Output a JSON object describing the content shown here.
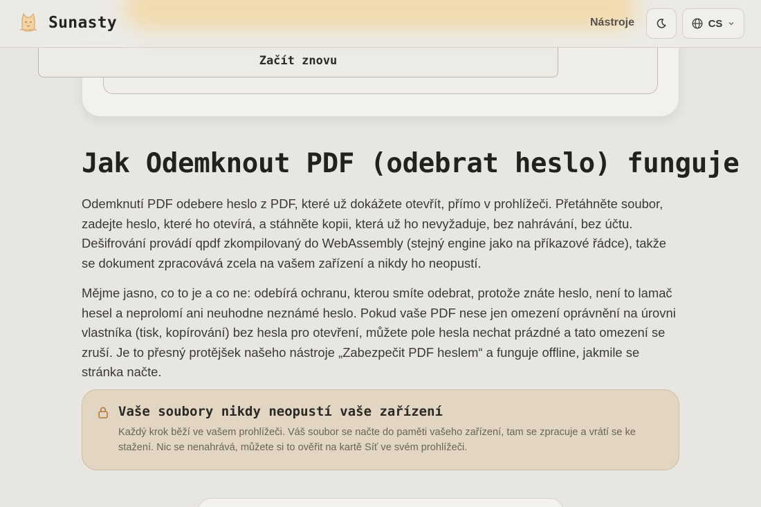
{
  "header": {
    "brand": "Sunasty",
    "nav_tools": "Nástroje",
    "lang": "CS",
    "icons": {
      "logo": "cat-logo-icon",
      "theme": "moon-icon",
      "globe": "globe-icon",
      "chevron": "chevron-down-icon"
    }
  },
  "card": {
    "restart_label": "Začít znovu"
  },
  "main": {
    "title": "Jak Odemknout PDF (odebrat heslo) funguje",
    "paragraph1": "Odemknutí PDF odebere heslo z PDF, které už dokážete otevřít, přímo v prohlížeči. Přetáhněte soubor, zadejte heslo, které ho otevírá, a stáhněte kopii, která už ho nevyžaduje, bez nahrávání, bez účtu. Dešifrování provádí qpdf zkompilovaný do WebAssembly (stejný engine jako na příkazové řádce), takže se dokument zpracovává zcela na vašem zařízení a nikdy ho neopustí.",
    "paragraph2": "Mějme jasno, co to je a co ne: odebírá ochranu, kterou smíte odebrat, protože znáte heslo, není to lamač hesel a neprolomí ani neuhodne neznámé heslo. Pokud vaše PDF nese jen omezení oprávnění na úrovni vlastníka (tisk, kopírování) bez hesla pro otevření, můžete pole hesla nechat prázdné a tato omezení se zruší. Je to přesný protějšek našeho nástroje „Zabezpečit PDF heslem“ a funguje offline, jakmile se stránka načte."
  },
  "privacy_note": {
    "icon": "lock-icon",
    "title": "Vaše soubory nikdy neopustí vaše zařízení",
    "text": "Každý krok běží ve vašem prohlížeči. Váš soubor se načte do paměti vašeho zařízení, tam se zpracuje a vrátí se ke stažení. Nic se nenahrává, můžete si to ověřit na kartě Síť ve svém prohlížeči."
  },
  "colors": {
    "background": "#e8e6e1",
    "note_bg": "#e2d6c3",
    "accent": "#b07a3a"
  }
}
